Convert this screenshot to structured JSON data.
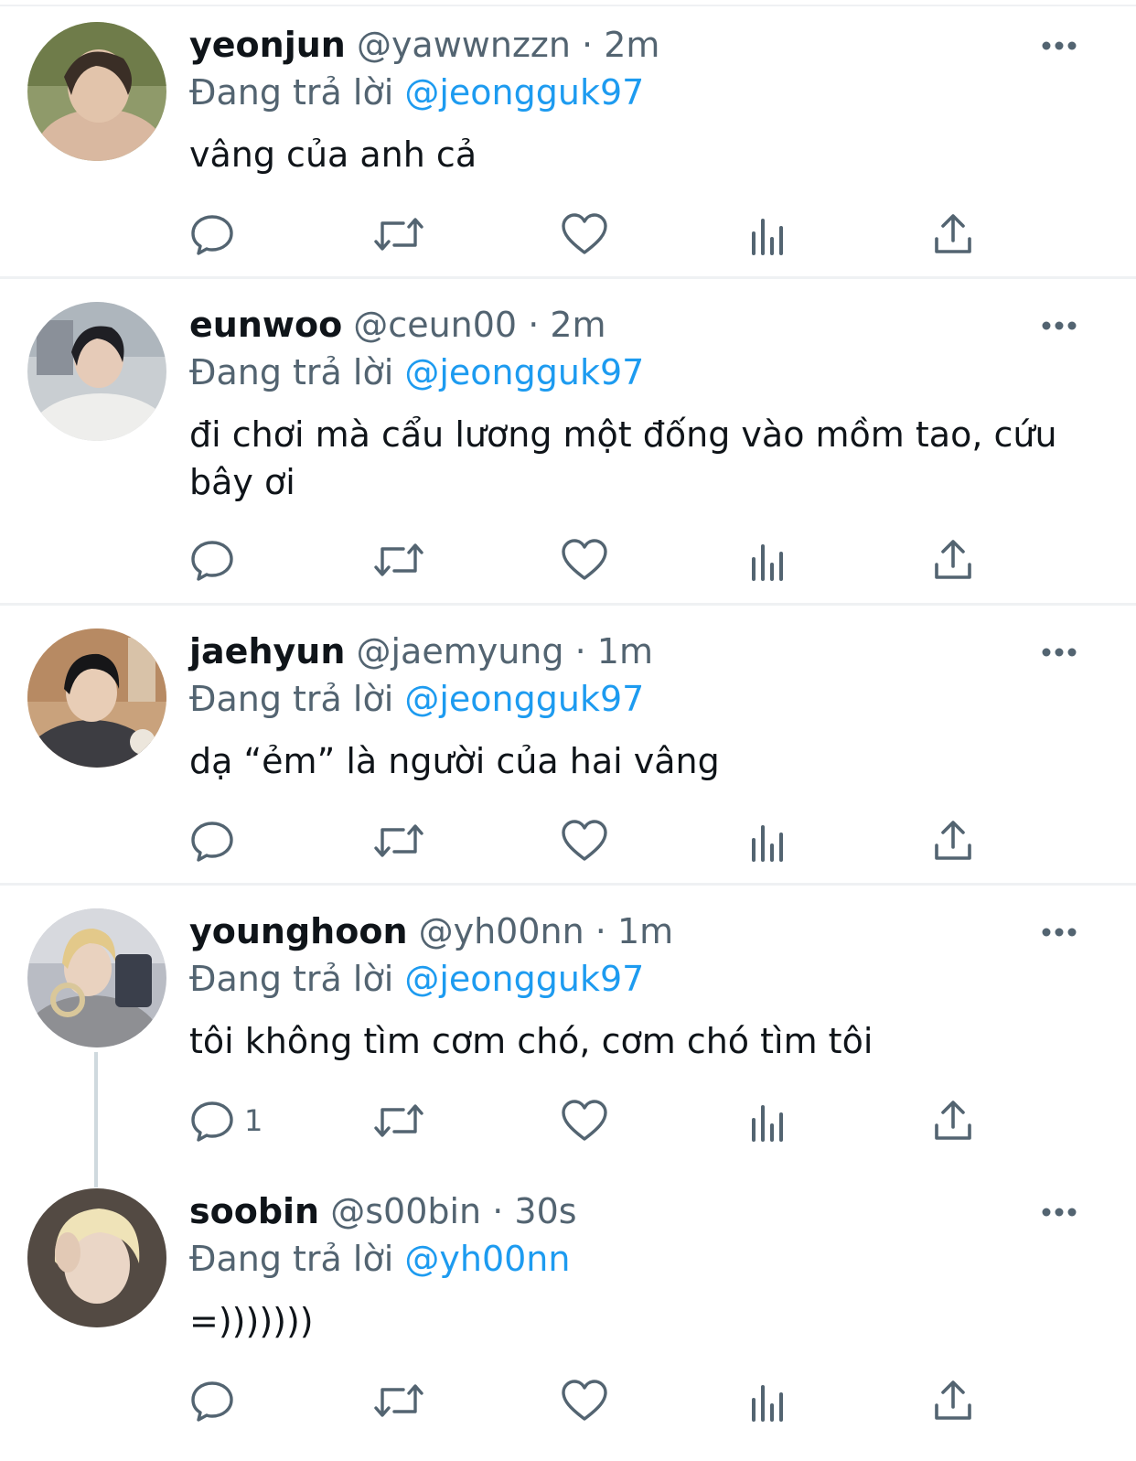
{
  "colors": {
    "link": "#1d9bf0",
    "muted": "#536471",
    "text": "#0f1419",
    "divider": "#eff1f3",
    "thread_line": "#cfd9de"
  },
  "tweets": [
    {
      "name": "yeonjun",
      "handle": "@yawwnzzn",
      "dot": "·",
      "time": "2m",
      "reply_prefix": "Đang trả lời",
      "reply_to": "@jeongguk97",
      "text": "vâng của anh cả",
      "reply_count": ""
    },
    {
      "name": "eunwoo",
      "handle": "@ceun00",
      "dot": "·",
      "time": "2m",
      "reply_prefix": "Đang trả lời",
      "reply_to": "@jeongguk97",
      "text": "đi chơi mà cẩu lương một đống vào mồm tao, cứu bây ơi",
      "reply_count": ""
    },
    {
      "name": "jaehyun",
      "handle": "@jaemyung",
      "dot": "·",
      "time": "1m",
      "reply_prefix": "Đang trả lời",
      "reply_to": "@jeongguk97",
      "text": "dạ “ẻm” là người của hai vâng",
      "reply_count": ""
    },
    {
      "name": "younghoon",
      "handle": "@yh00nn",
      "dot": "·",
      "time": "1m",
      "reply_prefix": "Đang trả lời",
      "reply_to": "@jeongguk97",
      "text": "tôi không tìm cơm chó, cơm chó tìm tôi",
      "reply_count": "1"
    },
    {
      "name": "soobin",
      "handle": "@s00bin",
      "dot": "·",
      "time": "30s",
      "reply_prefix": "Đang trả lời",
      "reply_to": "@yh00nn",
      "text": "=)))))))",
      "reply_count": ""
    }
  ],
  "icons": {
    "reply": "reply-icon",
    "retweet": "retweet-icon",
    "like": "heart-icon",
    "views": "views-icon",
    "share": "share-icon",
    "more": "more-icon"
  }
}
